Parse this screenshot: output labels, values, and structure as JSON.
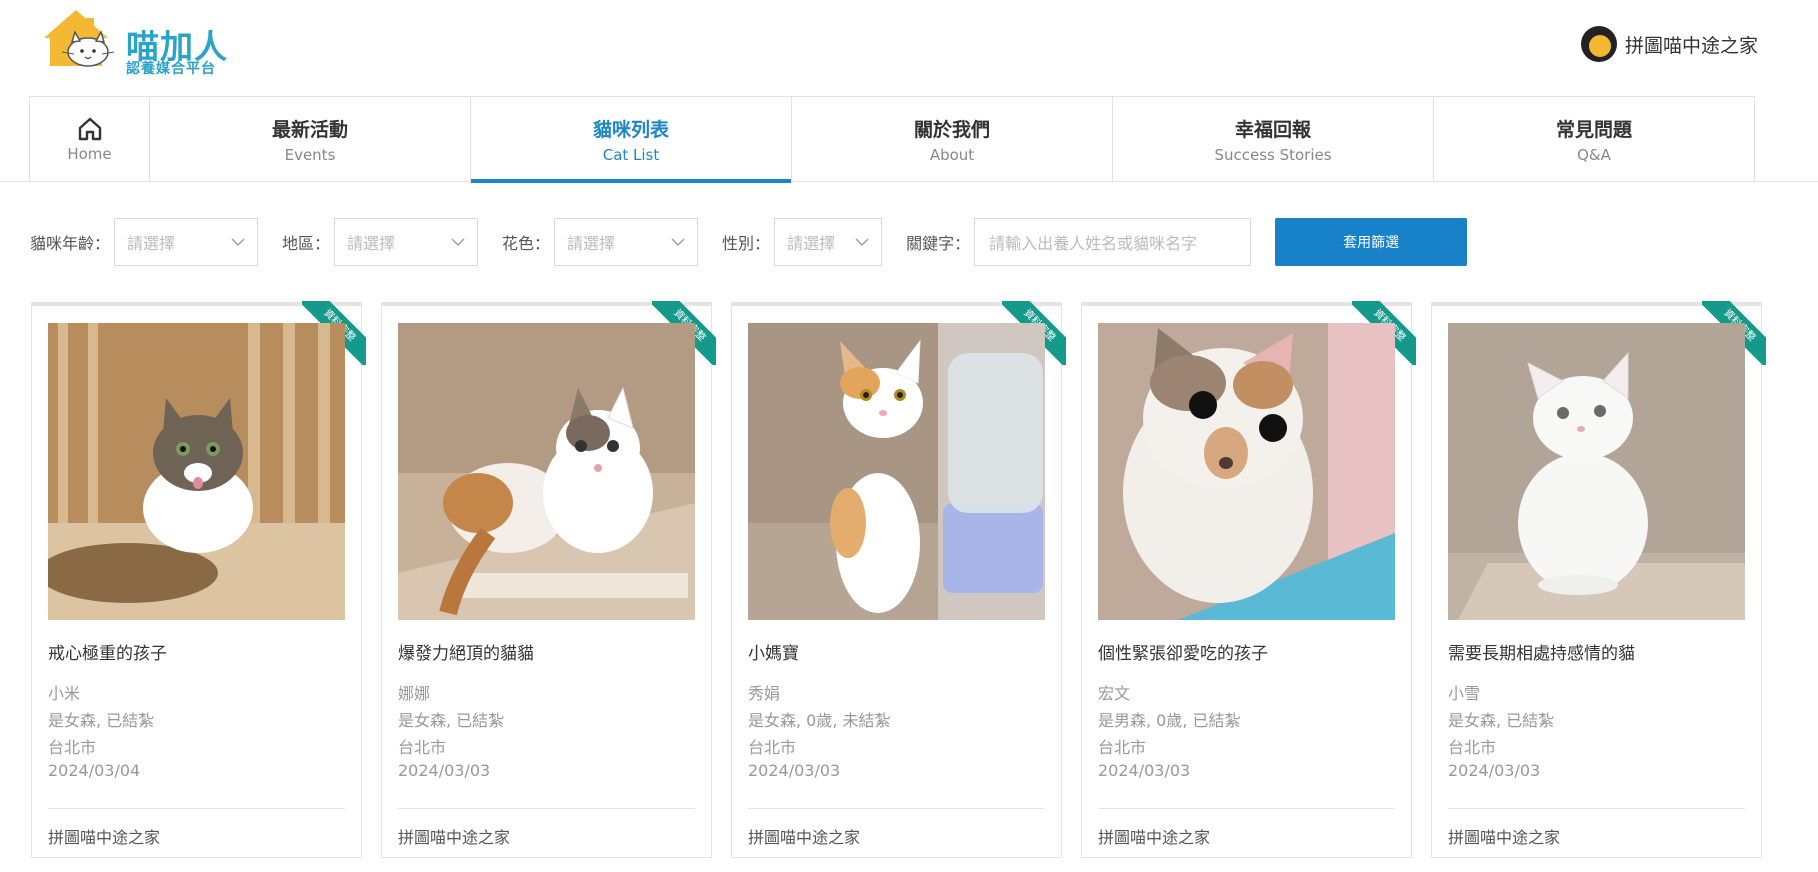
{
  "logo": {
    "main_text": "喵加人",
    "sub_text": "認養媒合平台"
  },
  "user": {
    "name": "拼圖喵中途之家"
  },
  "nav": {
    "home": {
      "label_en": "Home"
    },
    "items": [
      {
        "label_zh": "最新活動",
        "label_en": "Events"
      },
      {
        "label_zh": "貓咪列表",
        "label_en": "Cat List"
      },
      {
        "label_zh": "關於我們",
        "label_en": "About"
      },
      {
        "label_zh": "幸福回報",
        "label_en": "Success Stories"
      },
      {
        "label_zh": "常見問題",
        "label_en": "Q&A"
      }
    ]
  },
  "filters": {
    "age_label": "貓咪年齡：",
    "region_label": "地區：",
    "color_label": "花色：",
    "gender_label": "性別：",
    "keyword_label": "關鍵字：",
    "select_placeholder": "請選擇",
    "keyword_placeholder": "請輸入出養人姓名或貓咪名字",
    "apply_label": "套用篩選"
  },
  "cards": [
    {
      "ribbon": "資料完整",
      "title": "戒心極重的孩子",
      "name": "小米",
      "info": "是女森, 已結紮",
      "city": "台北市",
      "date": "2024/03/04",
      "shelter": "拼圖喵中途之家"
    },
    {
      "ribbon": "資料完整",
      "title": "爆發力絕頂的貓貓",
      "name": "娜娜",
      "info": "是女森, 已結紮",
      "city": "台北市",
      "date": "2024/03/03",
      "shelter": "拼圖喵中途之家"
    },
    {
      "ribbon": "資料完整",
      "title": "小媽寶",
      "name": "秀娟",
      "info": "是女森, 0歲, 未結紮",
      "city": "台北市",
      "date": "2024/03/03",
      "shelter": "拼圖喵中途之家"
    },
    {
      "ribbon": "資料完整",
      "title": "個性緊張卻愛吃的孩子",
      "name": "宏文",
      "info": "是男森, 0歲, 已結紮",
      "city": "台北市",
      "date": "2024/03/03",
      "shelter": "拼圖喵中途之家"
    },
    {
      "ribbon": "資料完整",
      "title": "需要長期相處持感情的貓",
      "name": "小雪",
      "info": "是女森, 已結紮",
      "city": "台北市",
      "date": "2024/03/03",
      "shelter": "拼圖喵中途之家"
    }
  ],
  "colors": {
    "accent": "#1f86c6",
    "button": "#1781c9",
    "ribbon": "#139a8b",
    "logo_text": "#2aa3c9",
    "logo_house": "#f5b833"
  }
}
